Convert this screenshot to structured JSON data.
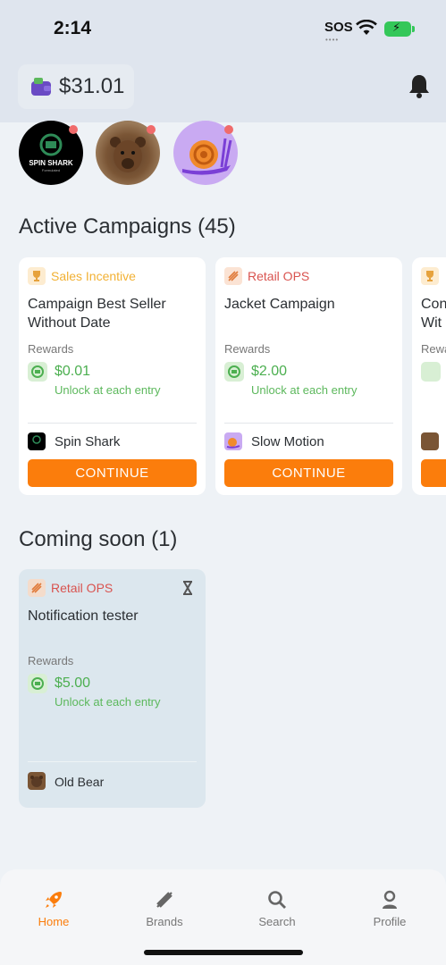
{
  "status": {
    "time": "2:14",
    "sos": "SOS",
    "sos_dots": "••••"
  },
  "wallet": {
    "balance": "$31.01"
  },
  "sections": {
    "active_title": "Active Campaigns (45)",
    "soon_title": "Coming soon (1)"
  },
  "featured_brands": {
    "spin_shark_logo_text": "SPIN SHARK",
    "spin_shark_logo_sub": "Formulated"
  },
  "active_campaigns": [
    {
      "category": "Sales Incentive",
      "title": "Campaign Best Seller Without Date",
      "rewards_label": "Rewards",
      "amount": "$0.01",
      "note": "Unlock at each entry",
      "brand": "Spin Shark",
      "cta": "CONTINUE"
    },
    {
      "category": "Retail OPS",
      "title": "Jacket Campaign",
      "rewards_label": "Rewards",
      "amount": "$2.00",
      "note": "Unlock at each entry",
      "brand": "Slow Motion",
      "cta": "CONTINUE"
    },
    {
      "title_fragment_1": "Con",
      "title_fragment_2": "Wit",
      "rewards_fragment": "Rewa"
    }
  ],
  "coming_soon": [
    {
      "category": "Retail OPS",
      "title": "Notification tester",
      "rewards_label": "Rewards",
      "amount": "$5.00",
      "note": "Unlock at each entry",
      "brand": "Old Bear"
    }
  ],
  "nav": [
    {
      "label": "Home",
      "icon": "rocket-icon",
      "active": true
    },
    {
      "label": "Brands",
      "icon": "brands-icon",
      "active": false
    },
    {
      "label": "Search",
      "icon": "search-icon",
      "active": false
    },
    {
      "label": "Profile",
      "icon": "profile-icon",
      "active": false
    }
  ],
  "colors": {
    "accent": "#fb7d0c",
    "reward_green": "#4caf50",
    "sales_incentive": "#f2b134",
    "retail_ops": "#d9534f",
    "notification_dot": "#f06b6b"
  }
}
